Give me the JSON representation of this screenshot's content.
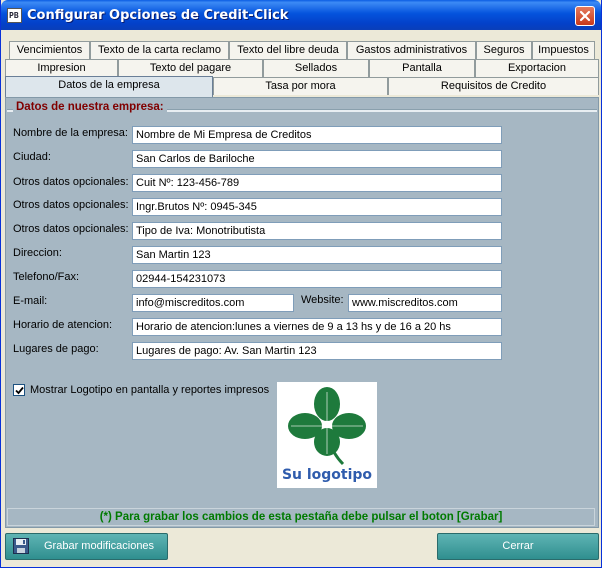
{
  "window": {
    "title": "Configurar Opciones de Credit-Click",
    "app_icon_text": "PB"
  },
  "tabs": {
    "row1": [
      "Vencimientos",
      "Texto de la carta reclamo",
      "Texto del libre deuda",
      "Gastos administrativos",
      "Seguros",
      "Impuestos"
    ],
    "row2": [
      "Impresion",
      "Texto del pagare",
      "Sellados",
      "Pantalla",
      "Exportacion"
    ],
    "row3": [
      "Datos de la empresa",
      "Tasa por mora",
      "Requisitos de Credito"
    ],
    "active": "Datos de la empresa"
  },
  "form": {
    "group_title": "Datos de nuestra empresa:",
    "fields": [
      {
        "label": "Nombre de la empresa:",
        "value": "Nombre de Mi Empresa de Creditos"
      },
      {
        "label": "Ciudad:",
        "value": "San Carlos de Bariloche"
      },
      {
        "label": "Otros datos opcionales:",
        "value": "Cuit Nº: 123-456-789"
      },
      {
        "label": "Otros datos opcionales:",
        "value": "Ingr.Brutos Nº: 0945-345"
      },
      {
        "label": "Otros datos opcionales:",
        "value": "Tipo de Iva: Monotributista"
      },
      {
        "label": "Direccion:",
        "value": "San Martin 123"
      },
      {
        "label": "Telefono/Fax:",
        "value": "02944-154231073"
      },
      {
        "label": "E-mail:",
        "value": "info@miscreditos.com"
      },
      {
        "label": "Horario de atencion:",
        "value": "Horario de atencion:lunes a viernes de 9 a 13 hs y de 16 a 20 hs"
      },
      {
        "label": "Lugares de pago:",
        "value": "Lugares de pago: Av. San Martin 123"
      }
    ],
    "website_label": "Website:",
    "website_value": "www.miscreditos.com",
    "show_logo_label": "Mostrar Logotipo en pantalla y reportes impresos",
    "show_logo_checked": true,
    "logo_text": "Su logotipo"
  },
  "notice": "(*) Para grabar los cambios de esta pestaña debe pulsar el boton [Grabar]",
  "buttons": {
    "save": "Grabar modificaciones",
    "close": "Cerrar"
  },
  "colors": {
    "panel": "#a6b7c3",
    "group_title": "#800000",
    "notice": "#007a00",
    "button": "#3d9a9a",
    "clover": "#1e7a3c",
    "logo_text": "#2f5cad"
  }
}
